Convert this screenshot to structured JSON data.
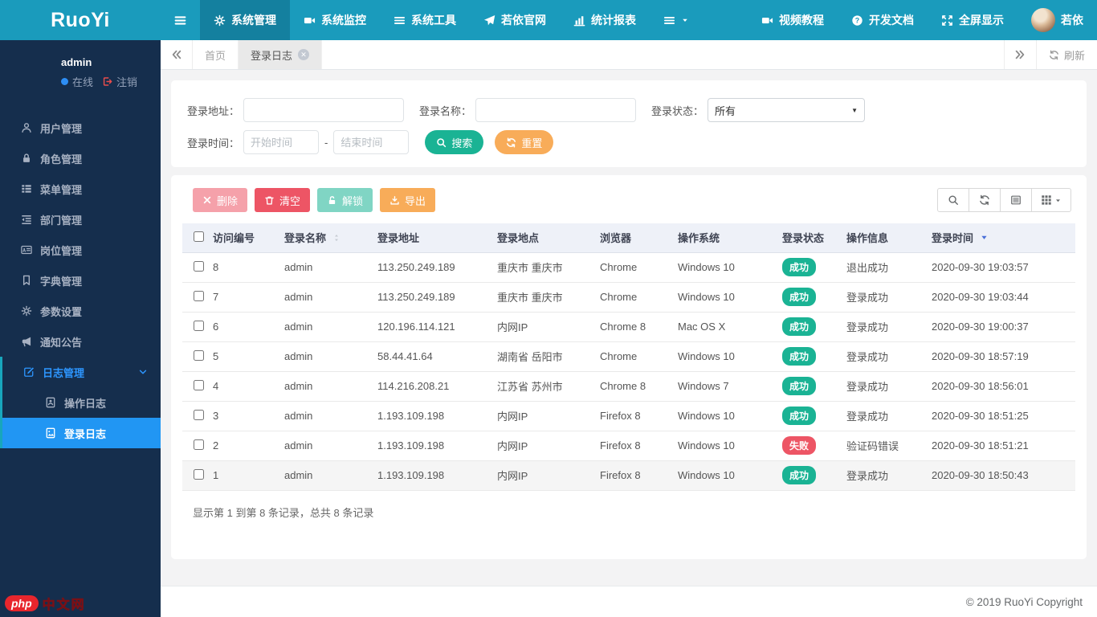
{
  "topnav": {
    "logo": "RuoYi",
    "items": [
      {
        "label": "系统管理",
        "icon": "gear-icon",
        "active": true
      },
      {
        "label": "系统监控",
        "icon": "video-icon",
        "active": false
      },
      {
        "label": "系统工具",
        "icon": "bars-icon",
        "active": false
      },
      {
        "label": "若依官网",
        "icon": "paper-plane-icon",
        "active": false
      },
      {
        "label": "统计报表",
        "icon": "bar-chart-icon",
        "active": false
      }
    ],
    "right_items": [
      {
        "label": "视频教程",
        "icon": "video-icon"
      },
      {
        "label": "开发文档",
        "icon": "question-circle-icon"
      },
      {
        "label": "全屏显示",
        "icon": "fullscreen-icon"
      }
    ],
    "user_name": "若依"
  },
  "tabs": {
    "items": [
      {
        "label": "首页",
        "active": false,
        "closable": false
      },
      {
        "label": "登录日志",
        "active": true,
        "closable": true
      }
    ],
    "refresh_label": "刷新"
  },
  "sidebar": {
    "user": {
      "name": "admin",
      "status": "在线",
      "logout": "注销"
    },
    "items": [
      {
        "label": "用户管理",
        "icon": "user-icon"
      },
      {
        "label": "角色管理",
        "icon": "lock-icon"
      },
      {
        "label": "菜单管理",
        "icon": "list-icon"
      },
      {
        "label": "部门管理",
        "icon": "outdent-icon"
      },
      {
        "label": "岗位管理",
        "icon": "id-card-icon"
      },
      {
        "label": "字典管理",
        "icon": "bookmark-icon"
      },
      {
        "label": "参数设置",
        "icon": "sun-gear-icon"
      },
      {
        "label": "通知公告",
        "icon": "bullhorn-icon"
      },
      {
        "label": "日志管理",
        "icon": "edit-icon",
        "open": true,
        "children": [
          {
            "label": "操作日志",
            "icon": "address-book-icon",
            "active": false
          },
          {
            "label": "登录日志",
            "icon": "file-image-icon",
            "active": true
          }
        ]
      }
    ]
  },
  "search": {
    "ip_label": "登录地址：",
    "name_label": "登录名称：",
    "status_label": "登录状态：",
    "status_value": "所有",
    "time_label": "登录时间：",
    "start_placeholder": "开始时间",
    "end_placeholder": "结束时间",
    "separator": "-",
    "search_label": "搜索",
    "reset_label": "重置"
  },
  "toolbar": {
    "delete_label": "删除",
    "clear_label": "清空",
    "unlock_label": "解锁",
    "export_label": "导出"
  },
  "table": {
    "columns": [
      "访问编号",
      "登录名称",
      "登录地址",
      "登录地点",
      "浏览器",
      "操作系统",
      "登录状态",
      "操作信息",
      "登录时间"
    ],
    "rows": [
      {
        "id": "8",
        "name": "admin",
        "ip": "113.250.249.189",
        "location": "重庆市 重庆市",
        "browser": "Chrome",
        "os": "Windows 10",
        "status": "成功",
        "status_type": "success",
        "message": "退出成功",
        "time": "2020-09-30 19:03:57"
      },
      {
        "id": "7",
        "name": "admin",
        "ip": "113.250.249.189",
        "location": "重庆市 重庆市",
        "browser": "Chrome",
        "os": "Windows 10",
        "status": "成功",
        "status_type": "success",
        "message": "登录成功",
        "time": "2020-09-30 19:03:44"
      },
      {
        "id": "6",
        "name": "admin",
        "ip": "120.196.114.121",
        "location": "内网IP",
        "browser": "Chrome 8",
        "os": "Mac OS X",
        "status": "成功",
        "status_type": "success",
        "message": "登录成功",
        "time": "2020-09-30 19:00:37"
      },
      {
        "id": "5",
        "name": "admin",
        "ip": "58.44.41.64",
        "location": "湖南省 岳阳市",
        "browser": "Chrome",
        "os": "Windows 10",
        "status": "成功",
        "status_type": "success",
        "message": "登录成功",
        "time": "2020-09-30 18:57:19"
      },
      {
        "id": "4",
        "name": "admin",
        "ip": "114.216.208.21",
        "location": "江苏省 苏州市",
        "browser": "Chrome 8",
        "os": "Windows 7",
        "status": "成功",
        "status_type": "success",
        "message": "登录成功",
        "time": "2020-09-30 18:56:01"
      },
      {
        "id": "3",
        "name": "admin",
        "ip": "1.193.109.198",
        "location": "内网IP",
        "browser": "Firefox 8",
        "os": "Windows 10",
        "status": "成功",
        "status_type": "success",
        "message": "登录成功",
        "time": "2020-09-30 18:51:25"
      },
      {
        "id": "2",
        "name": "admin",
        "ip": "1.193.109.198",
        "location": "内网IP",
        "browser": "Firefox 8",
        "os": "Windows 10",
        "status": "失败",
        "status_type": "danger",
        "message": "验证码错误",
        "time": "2020-09-30 18:51:21"
      },
      {
        "id": "1",
        "name": "admin",
        "ip": "1.193.109.198",
        "location": "内网IP",
        "browser": "Firefox 8",
        "os": "Windows 10",
        "status": "成功",
        "status_type": "success",
        "message": "登录成功",
        "time": "2020-09-30 18:50:43"
      }
    ],
    "summary": "显示第 1 到第 8 条记录，总共 8 条记录"
  },
  "footer": {
    "copyright": "© 2019 RuoYi Copyright"
  },
  "watermark": {
    "brand": "php",
    "text": "中文网"
  },
  "colors": {
    "navbar": "#1a9bbc",
    "navbar_active": "#14809f",
    "sidebar": "#152e4d",
    "active_menu": "#2196f3",
    "success": "#1ab394",
    "danger": "#ed5565",
    "warning": "#f8ac59",
    "sort_active": "#4a6fd8"
  },
  "icons": [
    "hamburger-icon",
    "gear-icon",
    "video-icon",
    "bars-icon",
    "paper-plane-icon",
    "bar-chart-icon",
    "caret-down-icon",
    "question-circle-icon",
    "fullscreen-icon",
    "user-icon",
    "lock-icon",
    "list-icon",
    "outdent-icon",
    "id-card-icon",
    "bookmark-icon",
    "sun-gear-icon",
    "bullhorn-icon",
    "edit-icon",
    "address-book-icon",
    "file-image-icon",
    "chevron-down-icon",
    "angles-left-icon",
    "angles-right-icon",
    "refresh-icon",
    "search-icon",
    "trash-icon",
    "unlock-icon",
    "download-icon",
    "x-icon",
    "sort-icon",
    "sort-desc-icon",
    "list-view-icon",
    "columns-icon",
    "sign-out-icon",
    "online-dot",
    "close-icon"
  ]
}
